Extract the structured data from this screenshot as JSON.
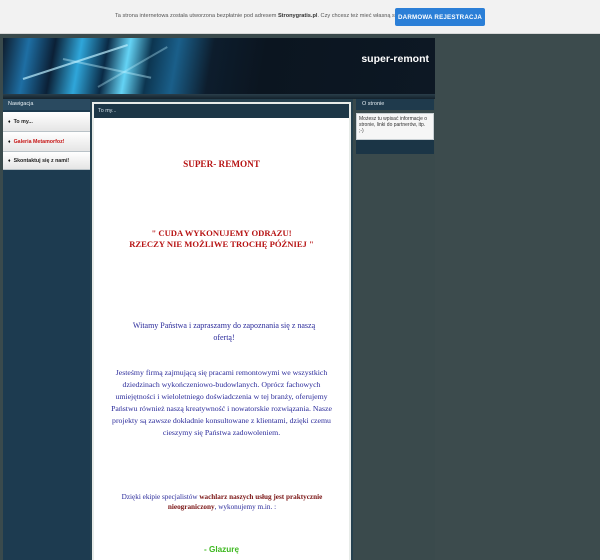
{
  "promo": {
    "message_prefix": "Ta strona internetowa została utworzona bezpłatnie pod adresem",
    "site_name": "Stronygratis.pl",
    "message_suffix": ". Czy chcesz też mieć własną stronę?",
    "register_button": "DARMOWA REJESTRACJA"
  },
  "header": {
    "site_title": "super-remont"
  },
  "nav": {
    "heading": "Nawigacja",
    "items": [
      {
        "label": "To my..."
      },
      {
        "label": "Galeria Metamorfoz!"
      },
      {
        "label": "Skontaktuj się z nami!"
      }
    ]
  },
  "main": {
    "section_title": "To my...",
    "heading": "SUPER- REMONT",
    "slogan_line1": "\" CUDA WYKONUJEMY ODRAZU!",
    "slogan_line2": "RZECZY NIE MOŻLIWE TROCHĘ PÓŹNIEJ  \"",
    "invite_line1": "Witamy Państwa i zapraszamy do zapoznania się z naszą",
    "invite_line2": "ofertą!",
    "description": [
      "Jesteśmy firmą zajmującą się pracami remontowymi  we wszystkich",
      "dziedzinach wykończeniowo-budowlanych. Oprócz fachowych",
      "umiejętności i wieloletniego doświadczenia w tej branży, oferujemy",
      "Państwu również naszą kreatywność i nowatorskie rozwiązania. Nasze",
      "projekty są zawsze dokładnie konsultowane z klientami, dzięki czemu",
      "cieszymy się Państwa zadowoleniem."
    ],
    "specialists_prefix": "Dzięki ekipie specjalistów",
    "specialists_bold": "wachlarz naszych usług jest praktycznie nieograniczony",
    "specialists_suffix": ", wykonujemy m.in. :",
    "list_first": "- Glazurę"
  },
  "about": {
    "heading": "O stronie",
    "text": "Możesz tu wpisać informacje o stronie, linki do partnerów, itp. ;-)"
  },
  "colors": {
    "accent_blue": "#2b7fd7",
    "heading_red": "#b71414",
    "body_blue": "#2a2a9a",
    "list_green": "#3cb81e"
  }
}
